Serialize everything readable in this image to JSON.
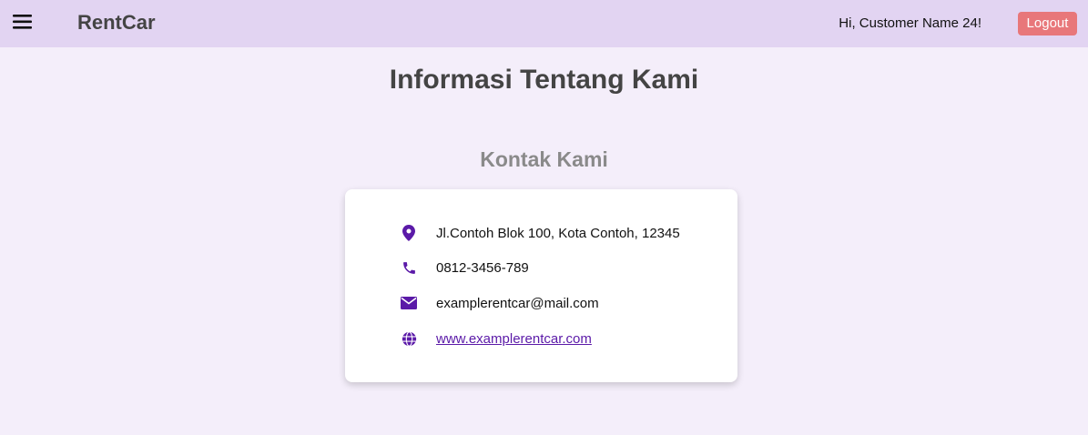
{
  "header": {
    "menu_icon": "hamburger-icon",
    "brand": "RentCar",
    "greeting": "Hi, Customer Name 24!",
    "logout_label": "Logout"
  },
  "main": {
    "page_title": "Informasi Tentang Kami",
    "section_title": "Kontak Kami",
    "contacts": [
      {
        "icon": "location-pin-icon",
        "text": "Jl.Contoh Blok 100, Kota Contoh, 12345"
      },
      {
        "icon": "phone-icon",
        "text": "0812-3456-789"
      },
      {
        "icon": "envelope-icon",
        "text": "examplerentcar@mail.com"
      },
      {
        "icon": "globe-icon",
        "text": "www.examplerentcar.com"
      }
    ]
  },
  "colors": {
    "navbar_bg": "#e2d4f2",
    "page_bg": "#f4eefa",
    "accent": "#5b1aa8",
    "logout_bg": "#e8777a"
  }
}
